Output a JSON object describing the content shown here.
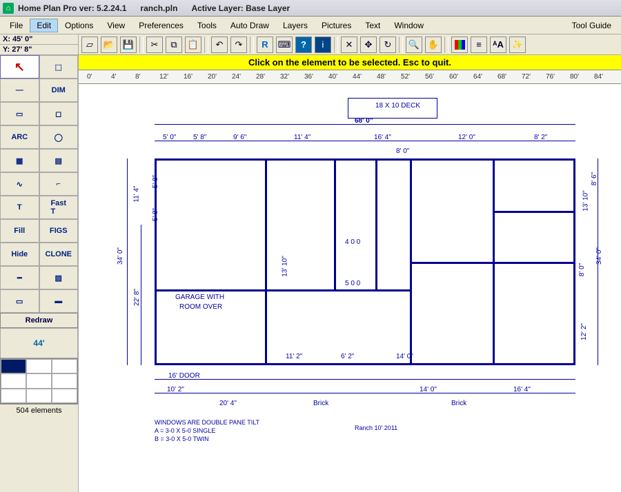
{
  "title": {
    "app": "Home Plan Pro ver:",
    "version": "5.2.24.1",
    "file": "ranch.pln",
    "layer_label": "Active Layer:",
    "layer": "Base Layer"
  },
  "menu": [
    "File",
    "Edit",
    "Options",
    "View",
    "Preferences",
    "Tools",
    "Auto Draw",
    "Layers",
    "Pictures",
    "Text",
    "Window",
    "Tool Guide"
  ],
  "coords": {
    "x_label": "X:",
    "x_val": "45' 0\"",
    "y_label": "Y:",
    "y_val": "27' 8\""
  },
  "hint": "Click on the element to be selected.  Esc to quit.",
  "tools": [
    {
      "id": "pointer",
      "glyph": "↖",
      "sel": true
    },
    {
      "id": "select-rect",
      "glyph": "⬚"
    },
    {
      "id": "line",
      "glyph": "—"
    },
    {
      "id": "dim",
      "glyph": "DIM"
    },
    {
      "id": "rect",
      "glyph": "▭"
    },
    {
      "id": "shape",
      "glyph": "◻"
    },
    {
      "id": "arc",
      "glyph": "ARC"
    },
    {
      "id": "circle",
      "glyph": "◯"
    },
    {
      "id": "grid",
      "glyph": "▦"
    },
    {
      "id": "fill-grid",
      "glyph": "▤"
    },
    {
      "id": "curve",
      "glyph": "∿"
    },
    {
      "id": "door",
      "glyph": "⌐"
    },
    {
      "id": "text",
      "glyph": "T"
    },
    {
      "id": "fast-text",
      "glyph": "Fast\nT"
    },
    {
      "id": "fill",
      "glyph": "Fill"
    },
    {
      "id": "figs",
      "glyph": "FIGS"
    },
    {
      "id": "hide",
      "glyph": "Hide"
    },
    {
      "id": "clone",
      "glyph": "CLONE"
    },
    {
      "id": "bold-line",
      "glyph": "━"
    },
    {
      "id": "pattern",
      "glyph": "▨"
    },
    {
      "id": "rect2",
      "glyph": "▭"
    },
    {
      "id": "rect-fill",
      "glyph": "▬"
    }
  ],
  "redraw": "Redraw",
  "status": "504 elements",
  "ruler": [
    "0'",
    "4'",
    "8'",
    "12'",
    "16'",
    "20'",
    "24'",
    "28'",
    "32'",
    "36'",
    "40'",
    "44'",
    "48'",
    "52'",
    "56'",
    "60'",
    "64'",
    "68'",
    "72'",
    "76'",
    "80'",
    "84'"
  ],
  "toolbar_icons": [
    "new",
    "open",
    "save",
    "",
    "cut",
    "copy",
    "paste",
    "",
    "undo",
    "redo",
    "",
    "ruler",
    "calc",
    "help",
    "info",
    "",
    "delete",
    "move",
    "rotate",
    "",
    "zoom",
    "hand",
    "",
    "rgb",
    "lines",
    "font",
    "effects"
  ],
  "plan": {
    "overall_width": "68' 0\"",
    "deck": "18 X 10 DECK",
    "dims_top": [
      "5' 0\"",
      "5' 8\"",
      "9' 6\"",
      "11' 4\"",
      "16' 4\"",
      "12' 0\"",
      "8' 2\""
    ],
    "dims_top2": "8' 0\"",
    "dims_bottom": [
      "10' 2\"",
      "20' 4\"",
      "11' 2\"",
      "6' 2\"",
      "14' 0\"",
      "14' 0\"",
      "16' 4\""
    ],
    "left_h": "34' 0\"",
    "left_h2": "22' 8\"",
    "left_h3": "11' 4\"",
    "left_h4": "5' 8\"",
    "left_h5": "5' 8\"",
    "right_h": "34' 0\"",
    "right_h2": "13' 10\"",
    "right_h3": "8' 0\"",
    "right_h4": "12' 2\"",
    "right_h5": "8' 6\"",
    "mid_h": "13' 10\"",
    "garage": "GARAGE WITH",
    "garage2": "ROOM OVER",
    "door16": "16' DOOR",
    "room_lbl1": "4 0 0",
    "room_lbl2": "5 0 0",
    "brick": "Brick",
    "notes1": "WINDOWS ARE DOUBLE PANE TILT",
    "notes2": "A = 3-0 X 5-0 SINGLE",
    "notes3": "B = 3-0 X 5-0 TWIN",
    "ranch_note": "Ranch 10' 2011"
  }
}
